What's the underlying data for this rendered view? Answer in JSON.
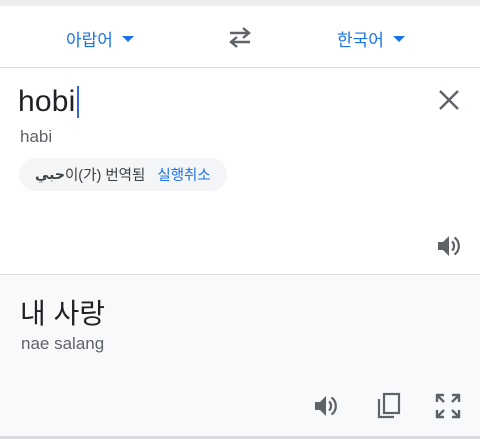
{
  "lang_bar": {
    "source_language": "아랍어",
    "target_language": "한국어",
    "swap_icon": "swap-arrows-icon"
  },
  "input": {
    "text": "hobi",
    "transliteration": "habi",
    "clear_icon": "close-icon"
  },
  "auto_correct": {
    "arabic_text": "حبي",
    "message": "이(가) 번역됨",
    "undo_label": "실행취소"
  },
  "result": {
    "text": "내 사랑",
    "transliteration": "nae salang",
    "tools": [
      "volume-icon",
      "copy-icon",
      "fullscreen-icon"
    ]
  },
  "colors": {
    "accent": "#1a73e8",
    "text_primary": "#202124",
    "text_secondary": "#5f6368",
    "result_bg": "#f8f9fa"
  }
}
